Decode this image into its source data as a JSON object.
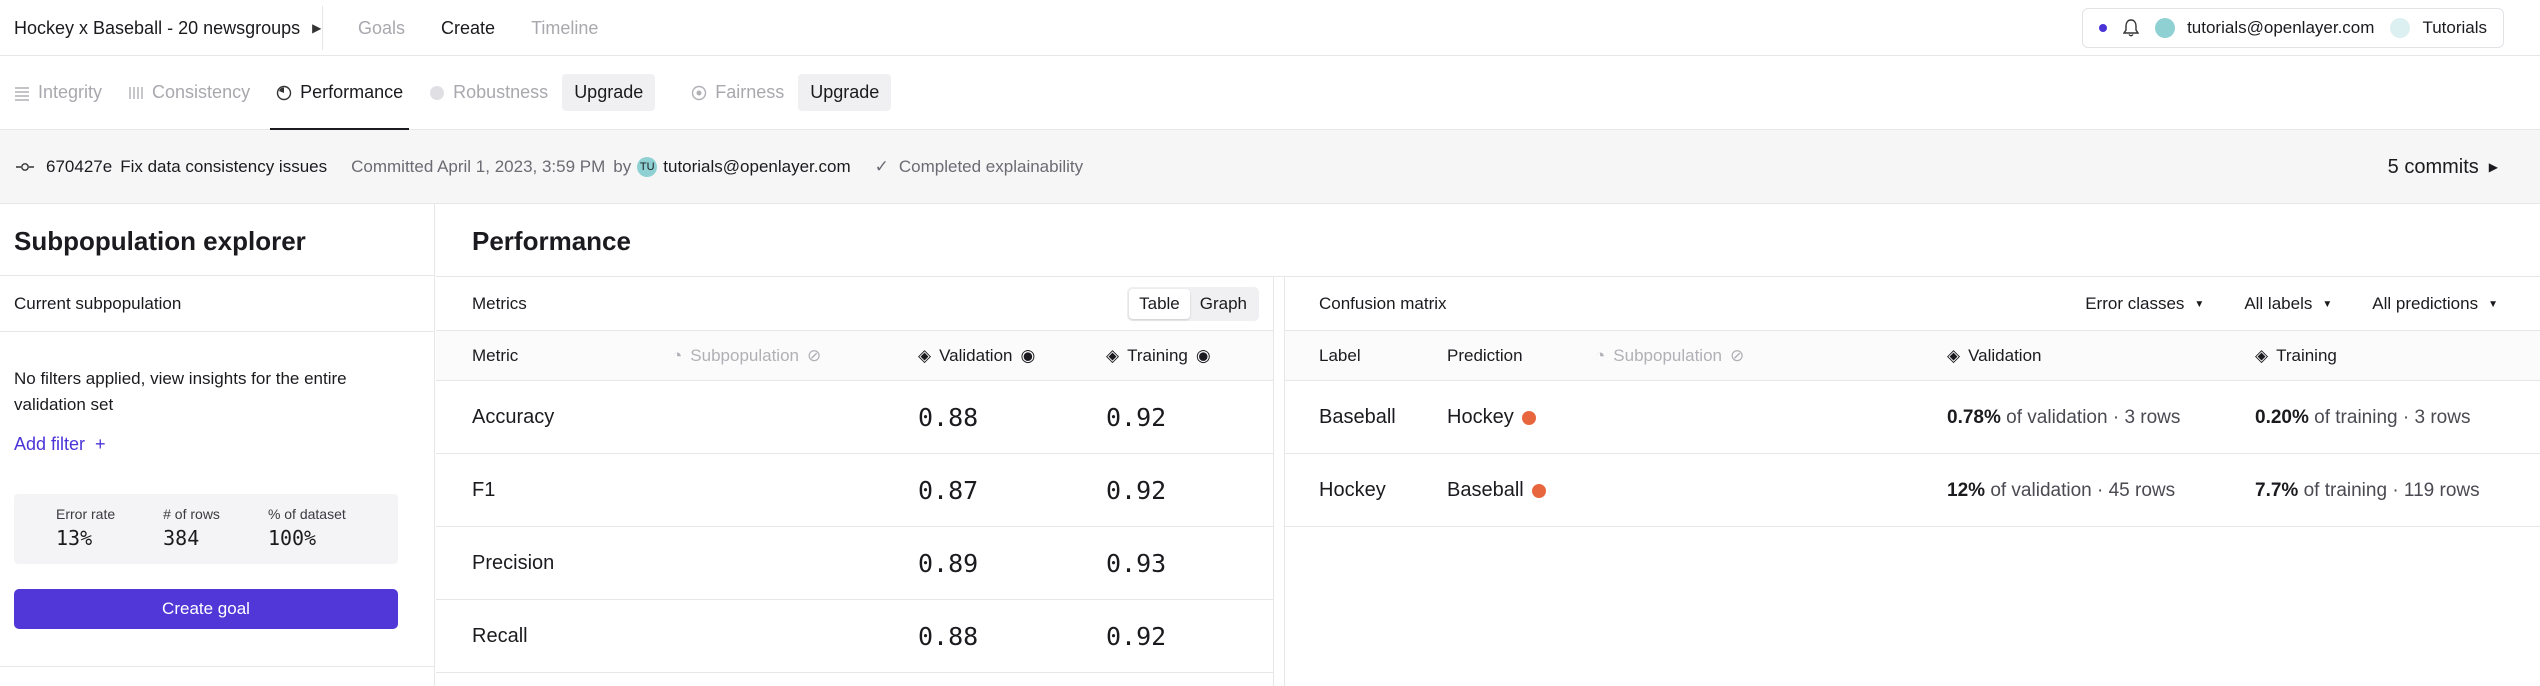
{
  "project": {
    "name": "Hockey x Baseball - 20 newsgroups"
  },
  "top_tabs": [
    "Goals",
    "Create",
    "Timeline"
  ],
  "top_active": "Create",
  "top_right": {
    "user": "tutorials@openlayer.com",
    "workspace": "Tutorials"
  },
  "sub_tabs": [
    {
      "label": "Integrity",
      "icon": "list-icon"
    },
    {
      "label": "Consistency",
      "icon": "bars-icon"
    },
    {
      "label": "Performance",
      "icon": "gauge-icon"
    },
    {
      "label": "Robustness",
      "icon": "circle-icon"
    },
    {
      "label": "Fairness",
      "icon": "scale-icon"
    }
  ],
  "upgrade_label": "Upgrade",
  "commit": {
    "hash": "670427e",
    "message": "Fix data consistency issues",
    "when": "Committed April 1, 2023, 3:59 PM",
    "by": "by",
    "initials": "TU",
    "user": "tutorials@openlayer.com",
    "status": "Completed explainability",
    "commits_label": "5 commits"
  },
  "left": {
    "title": "Subpopulation explorer",
    "current": "Current subpopulation",
    "no_filters": "No filters applied, view insights for the entire validation set",
    "add_filter": "Add filter",
    "stats": [
      {
        "label": "Error rate",
        "value": "13%"
      },
      {
        "label": "# of rows",
        "value": "384"
      },
      {
        "label": "% of dataset",
        "value": "100%"
      }
    ],
    "create_goal": "Create goal"
  },
  "performance_title": "Performance",
  "metrics": {
    "title": "Metrics",
    "toggle": [
      "Table",
      "Graph"
    ],
    "columns": [
      "Metric",
      "Subpopulation",
      "Validation",
      "Training"
    ],
    "rows": [
      {
        "metric": "Accuracy",
        "validation": "0.88",
        "training": "0.92"
      },
      {
        "metric": "F1",
        "validation": "0.87",
        "training": "0.92"
      },
      {
        "metric": "Precision",
        "validation": "0.89",
        "training": "0.93"
      },
      {
        "metric": "Recall",
        "validation": "0.88",
        "training": "0.92"
      }
    ]
  },
  "confusion": {
    "title": "Confusion matrix",
    "filters": [
      "Error classes",
      "All labels",
      "All predictions"
    ],
    "columns": [
      "Label",
      "Prediction",
      "Subpopulation",
      "Validation",
      "Training"
    ],
    "rows": [
      {
        "label": "Baseball",
        "prediction": "Hockey",
        "val_pct": "0.78%",
        "val_rest": "of validation · 3 rows",
        "train_pct": "0.20%",
        "train_rest": "of training · 3 rows"
      },
      {
        "label": "Hockey",
        "prediction": "Baseball",
        "val_pct": "12%",
        "val_rest": "of validation · 45 rows",
        "train_pct": "7.7%",
        "train_rest": "of training · 119 rows"
      }
    ]
  },
  "colors": {
    "accent": "#5237d8",
    "highlight": "#fbf6c9",
    "error_dot": "#e8663e"
  }
}
